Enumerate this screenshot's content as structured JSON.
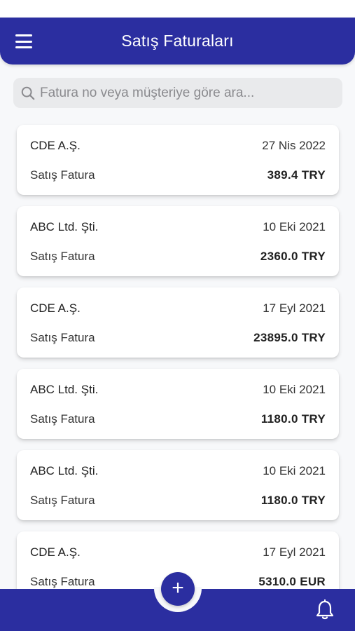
{
  "header": {
    "title": "Satış Faturaları",
    "menu_icon": "hamburger-menu-icon"
  },
  "search": {
    "placeholder": "Fatura no veya müşteriye göre ara...",
    "value": ""
  },
  "invoices": [
    {
      "customer": "CDE A.Ş.",
      "date": "27 Nis 2022",
      "type": "Satış Fatura",
      "amount": "389.4 TRY"
    },
    {
      "customer": "ABC Ltd. Şti.",
      "date": "10 Eki 2021",
      "type": "Satış Fatura",
      "amount": "2360.0 TRY"
    },
    {
      "customer": "CDE A.Ş.",
      "date": "17 Eyl 2021",
      "type": "Satış Fatura",
      "amount": "23895.0 TRY"
    },
    {
      "customer": "ABC Ltd. Şti.",
      "date": "10 Eki 2021",
      "type": "Satış Fatura",
      "amount": "1180.0 TRY"
    },
    {
      "customer": "ABC Ltd. Şti.",
      "date": "10 Eki 2021",
      "type": "Satış Fatura",
      "amount": "1180.0 TRY"
    },
    {
      "customer": "CDE A.Ş.",
      "date": "17 Eyl 2021",
      "type": "Satış Fatura",
      "amount": "5310.0 EUR"
    }
  ],
  "bottom_bar": {
    "fab_label": "+",
    "fab_icon": "plus-icon",
    "bell_icon": "bell-icon"
  },
  "colors": {
    "primary": "#2b2ea0",
    "background": "#f7f8fa",
    "card": "#ffffff",
    "search_bg": "#e9eaec"
  }
}
